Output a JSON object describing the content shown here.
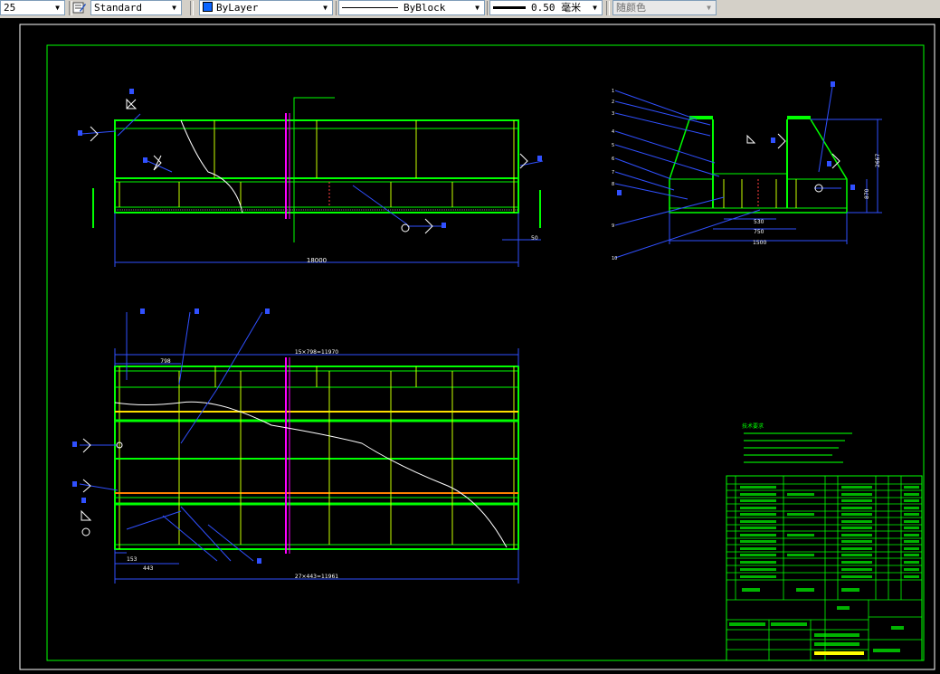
{
  "toolbar": {
    "scale_value": "25",
    "text_style": "Standard",
    "layer": "ByLayer",
    "linetype": "ByBlock",
    "lineweight": "0.50 毫米",
    "plot_color": "随颜色"
  },
  "drawing": {
    "top_view": {
      "overall_length_dim": "18000",
      "end_dim": "50"
    },
    "section_view": {
      "height_dim": "2667",
      "inner_height_dim": "870",
      "span_530": "530",
      "span_750": "750",
      "span_1500": "1500"
    },
    "plan_view": {
      "top_dim": "15×798=11970",
      "first_dim": "798",
      "bottom_dim": "27×443=11961",
      "small_dim_1": "153",
      "small_dim_2": "443"
    },
    "notes_title": "技术要求"
  }
}
